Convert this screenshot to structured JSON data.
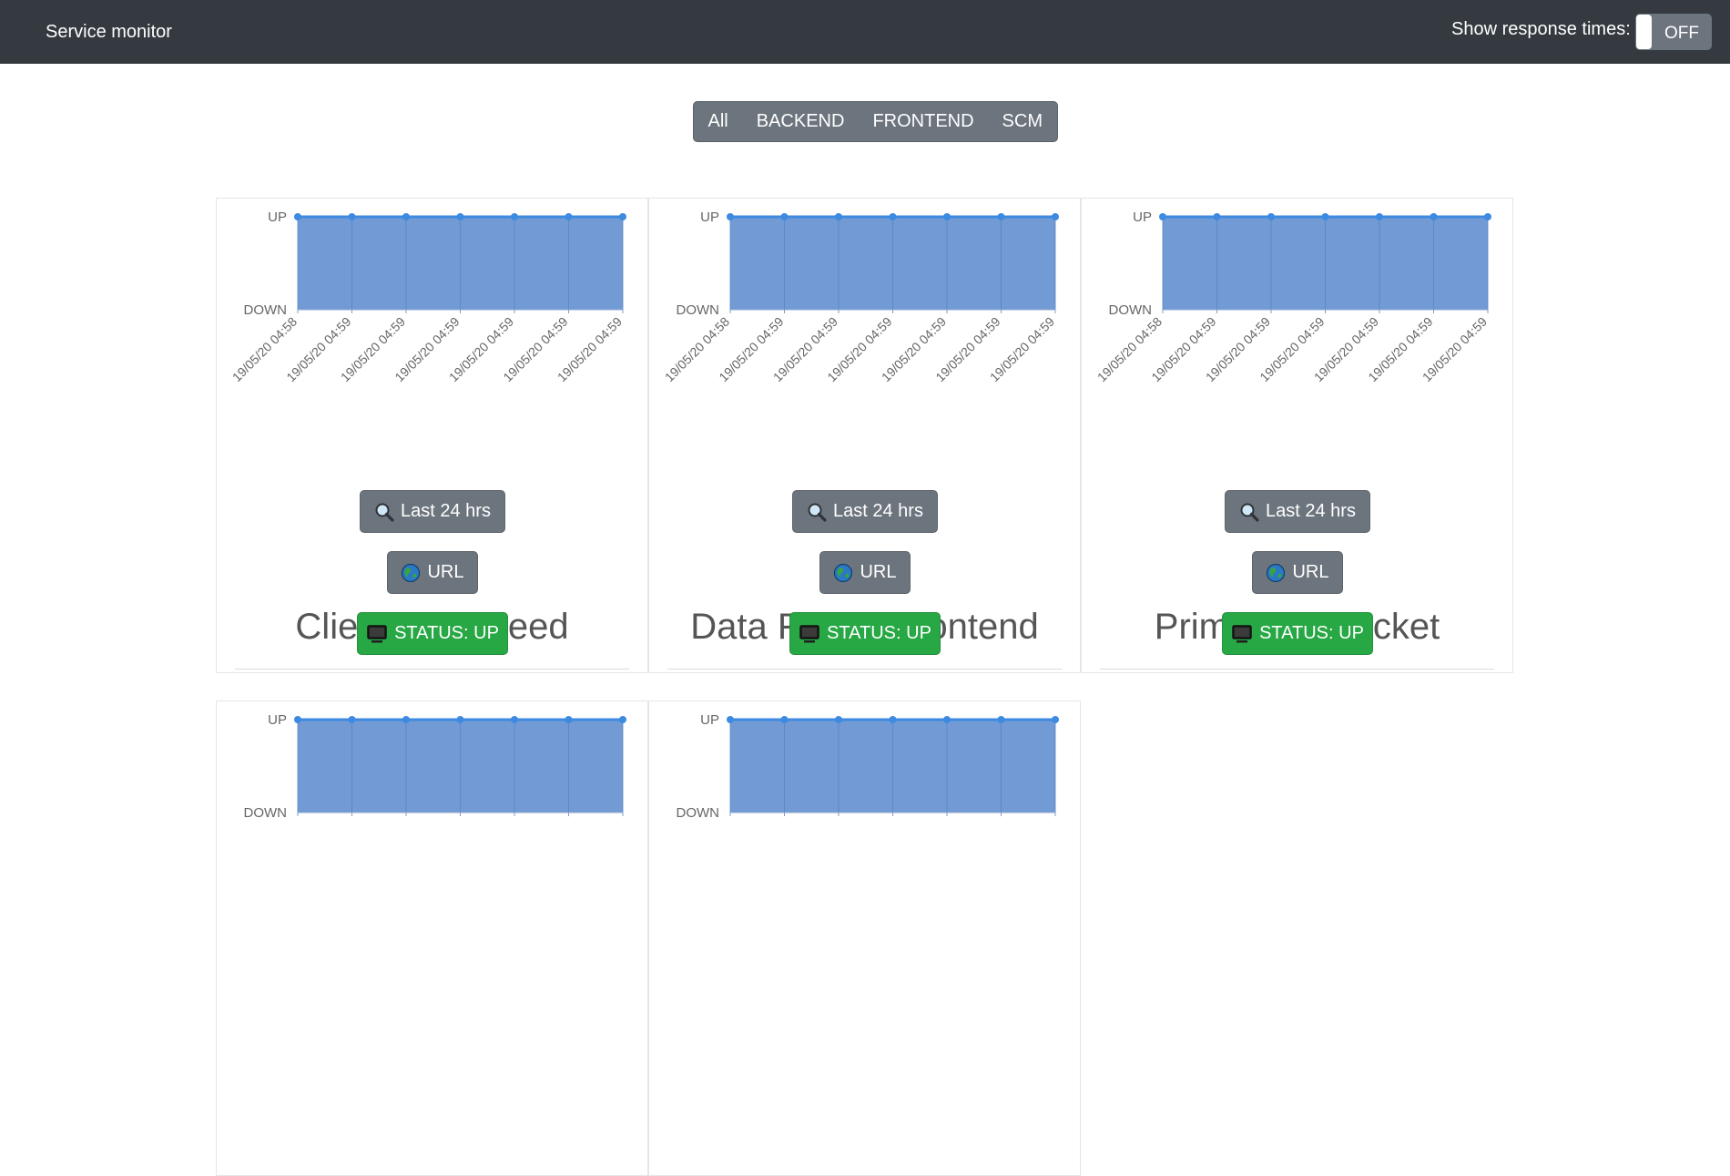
{
  "navbar": {
    "brand": "Service monitor",
    "response_times_label": "Show response times:",
    "response_times_toggle": "OFF"
  },
  "filters": [
    "All",
    "BACKEND",
    "FRONTEND",
    "SCM"
  ],
  "chart_axis": {
    "up_label": "UP",
    "down_label": "DOWN"
  },
  "services": [
    {
      "name": "Client Data Feed",
      "last24_label": "Last 24 hrs",
      "url_label": "URL",
      "status_label": "STATUS: UP",
      "chart_data": {
        "type": "area",
        "x": [
          "19/05/20 04:58",
          "19/05/20 04:59",
          "19/05/20 04:59",
          "19/05/20 04:59",
          "19/05/20 04:59",
          "19/05/20 04:59",
          "19/05/20 04:59"
        ],
        "y": [
          "UP",
          "UP",
          "UP",
          "UP",
          "UP",
          "UP",
          "UP"
        ],
        "y_categories": [
          "DOWN",
          "UP"
        ]
      }
    },
    {
      "name": "Data Feed - Frontend",
      "last24_label": "Last 24 hrs",
      "url_label": "URL",
      "status_label": "STATUS: UP",
      "chart_data": {
        "type": "area",
        "x": [
          "19/05/20 04:58",
          "19/05/20 04:59",
          "19/05/20 04:59",
          "19/05/20 04:59",
          "19/05/20 04:59",
          "19/05/20 04:59",
          "19/05/20 04:59"
        ],
        "y": [
          "UP",
          "UP",
          "UP",
          "UP",
          "UP",
          "UP",
          "UP"
        ],
        "y_categories": [
          "DOWN",
          "UP"
        ]
      }
    },
    {
      "name": "Primary Bitbucket",
      "last24_label": "Last 24 hrs",
      "url_label": "URL",
      "status_label": "STATUS: UP",
      "chart_data": {
        "type": "area",
        "x": [
          "19/05/20 04:58",
          "19/05/20 04:59",
          "19/05/20 04:59",
          "19/05/20 04:59",
          "19/05/20 04:59",
          "19/05/20 04:59",
          "19/05/20 04:59"
        ],
        "y": [
          "UP",
          "UP",
          "UP",
          "UP",
          "UP",
          "UP",
          "UP"
        ],
        "y_categories": [
          "DOWN",
          "UP"
        ]
      }
    },
    {
      "chart_data": {
        "type": "area",
        "y": [
          "UP",
          "UP",
          "UP",
          "UP",
          "UP",
          "UP",
          "UP"
        ],
        "y_categories": [
          "DOWN",
          "UP"
        ]
      }
    },
    {
      "chart_data": {
        "type": "area",
        "y": [
          "UP",
          "UP",
          "UP",
          "UP",
          "UP",
          "UP",
          "UP"
        ],
        "y_categories": [
          "DOWN",
          "UP"
        ]
      }
    }
  ],
  "colors": {
    "navbar_bg": "#343a40",
    "button_secondary": "#6c757d",
    "button_success": "#28a745",
    "chart_fill": "#729bd5",
    "chart_line": "#3d8ae0"
  },
  "icons": {
    "last24": "magnifier-icon",
    "url": "globe-icon",
    "status": "monitor-icon"
  }
}
